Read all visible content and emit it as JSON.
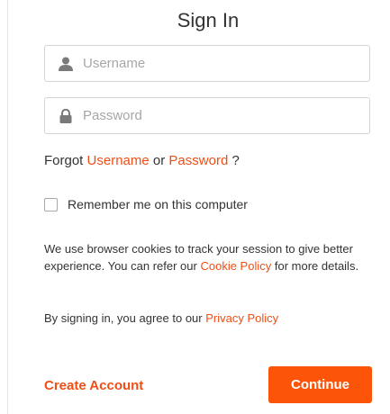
{
  "header": {
    "title": "Sign In"
  },
  "form": {
    "username": {
      "placeholder": "Username",
      "value": "",
      "icon": "user-icon"
    },
    "password": {
      "placeholder": "Password",
      "value": "",
      "icon": "lock-icon"
    },
    "forgot": {
      "prefix": "Forgot",
      "username_link": "Username",
      "or": "or",
      "password_link": "Password",
      "suffix": "?"
    },
    "remember": {
      "label": "Remember me on this computer",
      "checked": false
    }
  },
  "notices": {
    "cookies_text_before": "We use browser cookies to track your session to give better experience. You can refer our",
    "cookie_policy_link": "Cookie Policy",
    "cookies_text_after": "for more details.",
    "agree_text": "By signing in, you agree to our",
    "privacy_policy_link": "Privacy Policy"
  },
  "actions": {
    "create_account": "Create Account",
    "continue": "Continue"
  },
  "colors": {
    "accent": "#ef4f16",
    "button": "#fc5408",
    "icon": "#7a7a7a"
  }
}
